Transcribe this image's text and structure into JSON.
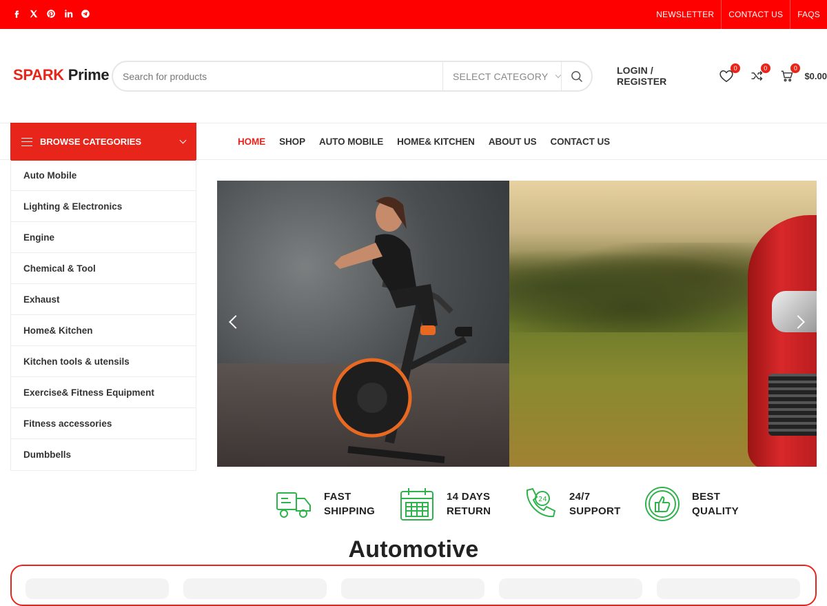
{
  "topbar": {
    "social_icons": [
      "facebook-icon",
      "x-icon",
      "pinterest-icon",
      "linkedin-icon",
      "telegram-icon"
    ],
    "links": [
      "NEWSLETTER",
      "CONTACT US",
      "FAQS"
    ],
    "bg_color": "#ff0000"
  },
  "header": {
    "logo_spark": "SPARK",
    "logo_prime": "Prime",
    "search_placeholder": "Search for products",
    "category_select": "SELECT CATEGORY",
    "login": "LOGIN / REGISTER",
    "wishlist_count": "0",
    "compare_count": "0",
    "cart_count": "0",
    "cart_total": "$0.00"
  },
  "nav": {
    "browse_label": "BROWSE CATEGORIES",
    "menu": [
      "HOME",
      "SHOP",
      "AUTO MOBILE",
      "HOME& KITCHEN",
      "ABOUT US",
      "CONTACT US"
    ],
    "active": "HOME"
  },
  "sidebar": {
    "items": [
      "Auto Mobile",
      "Lighting & Electronics",
      "Engine",
      "Chemical & Tool",
      "Exhaust",
      "Home& Kitchen",
      "Kitchen tools & utensils",
      "Exercise& Fitness Equipment",
      "Fitness accessories",
      "Dumbbells"
    ]
  },
  "features": [
    {
      "line1": "FAST",
      "line2": "SHIPPING",
      "icon": "truck-icon"
    },
    {
      "line1": "14 DAYS",
      "line2": "RETURN",
      "icon": "calendar-icon"
    },
    {
      "line1": "24/7",
      "line2": "SUPPORT",
      "icon": "phone-24-icon"
    },
    {
      "line1": "BEST",
      "line2": "QUALITY",
      "icon": "thumbs-up-icon"
    }
  ],
  "section": {
    "title": "Automotive"
  },
  "colors": {
    "accent": "#e8251b",
    "feature_green": "#2db34a"
  }
}
